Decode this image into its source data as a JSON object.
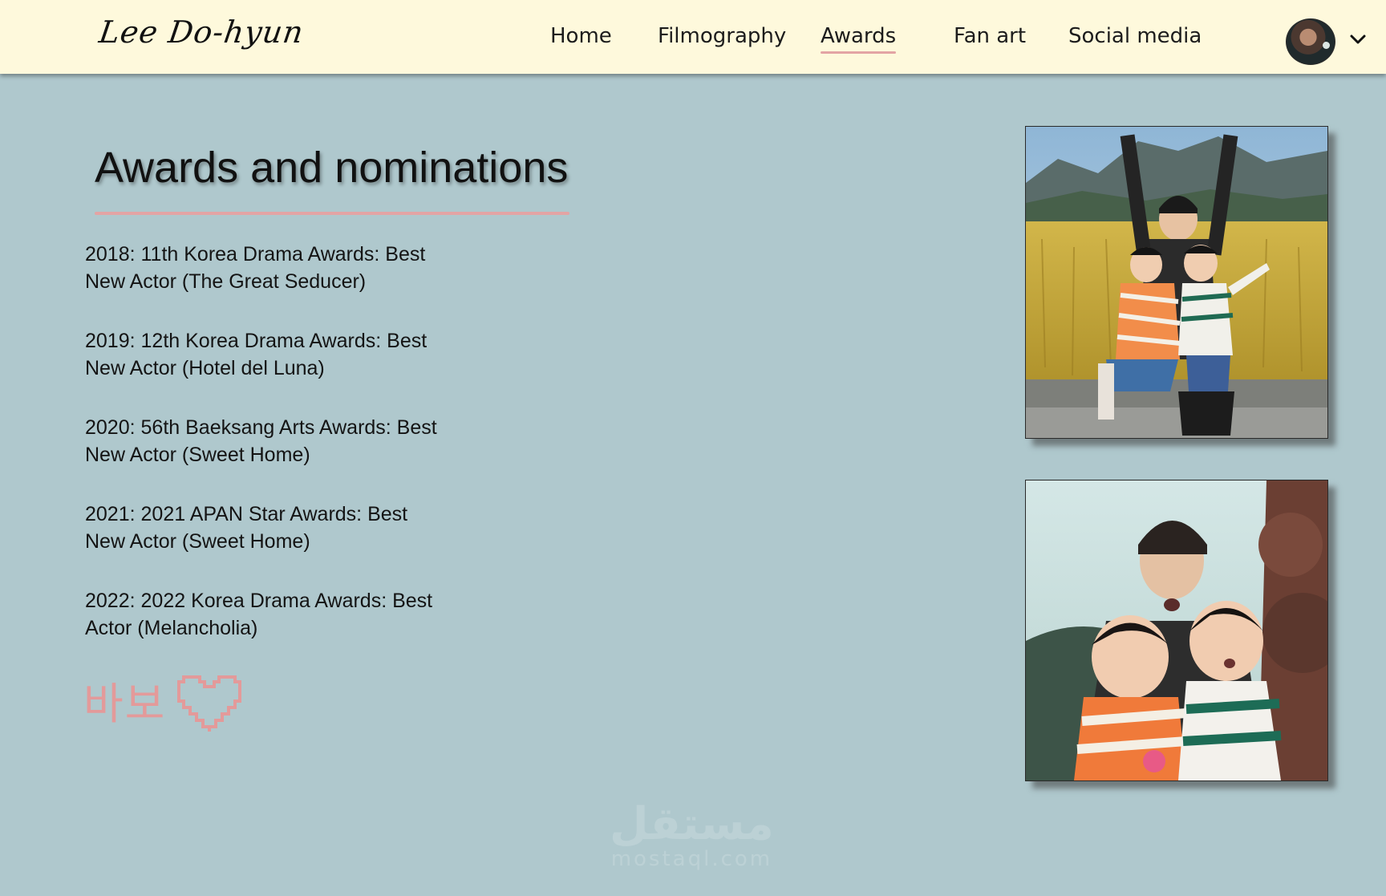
{
  "header": {
    "logo_text": "Lee Do-hyun",
    "nav": [
      {
        "label": "Home",
        "active": false
      },
      {
        "label": "Filmography",
        "active": false
      },
      {
        "label": "Awards",
        "active": true
      },
      {
        "label": "Fan art",
        "active": false
      },
      {
        "label": "Social media",
        "active": false
      }
    ],
    "avatar_icon": "profile-avatar",
    "menu_icon": "chevron-down-icon"
  },
  "main": {
    "title": "Awards and nominations",
    "awards": [
      {
        "line1": "2018: 11th Korea Drama Awards: Best",
        "line2": "New Actor (The Great Seducer)"
      },
      {
        "line1": "2019: 12th Korea Drama Awards: Best",
        "line2": "New Actor (Hotel del Luna)"
      },
      {
        "line1": "2020: 56th Baeksang Arts Awards: Best",
        "line2": "New Actor (Sweet Home)"
      },
      {
        "line1": "2021: 2021 APAN Star Awards: Best",
        "line2": "New Actor (Sweet Home)"
      },
      {
        "line1": "2022: 2022 Korea Drama Awards: Best",
        "line2": "Actor (Melancholia)"
      }
    ],
    "decoration_text": "바보"
  },
  "watermark": {
    "arabic": "مستقل",
    "latin": "mostaql.com"
  },
  "colors": {
    "header_bg": "#fef9dc",
    "page_bg": "#afc8cd",
    "accent": "#e3a4a4"
  }
}
